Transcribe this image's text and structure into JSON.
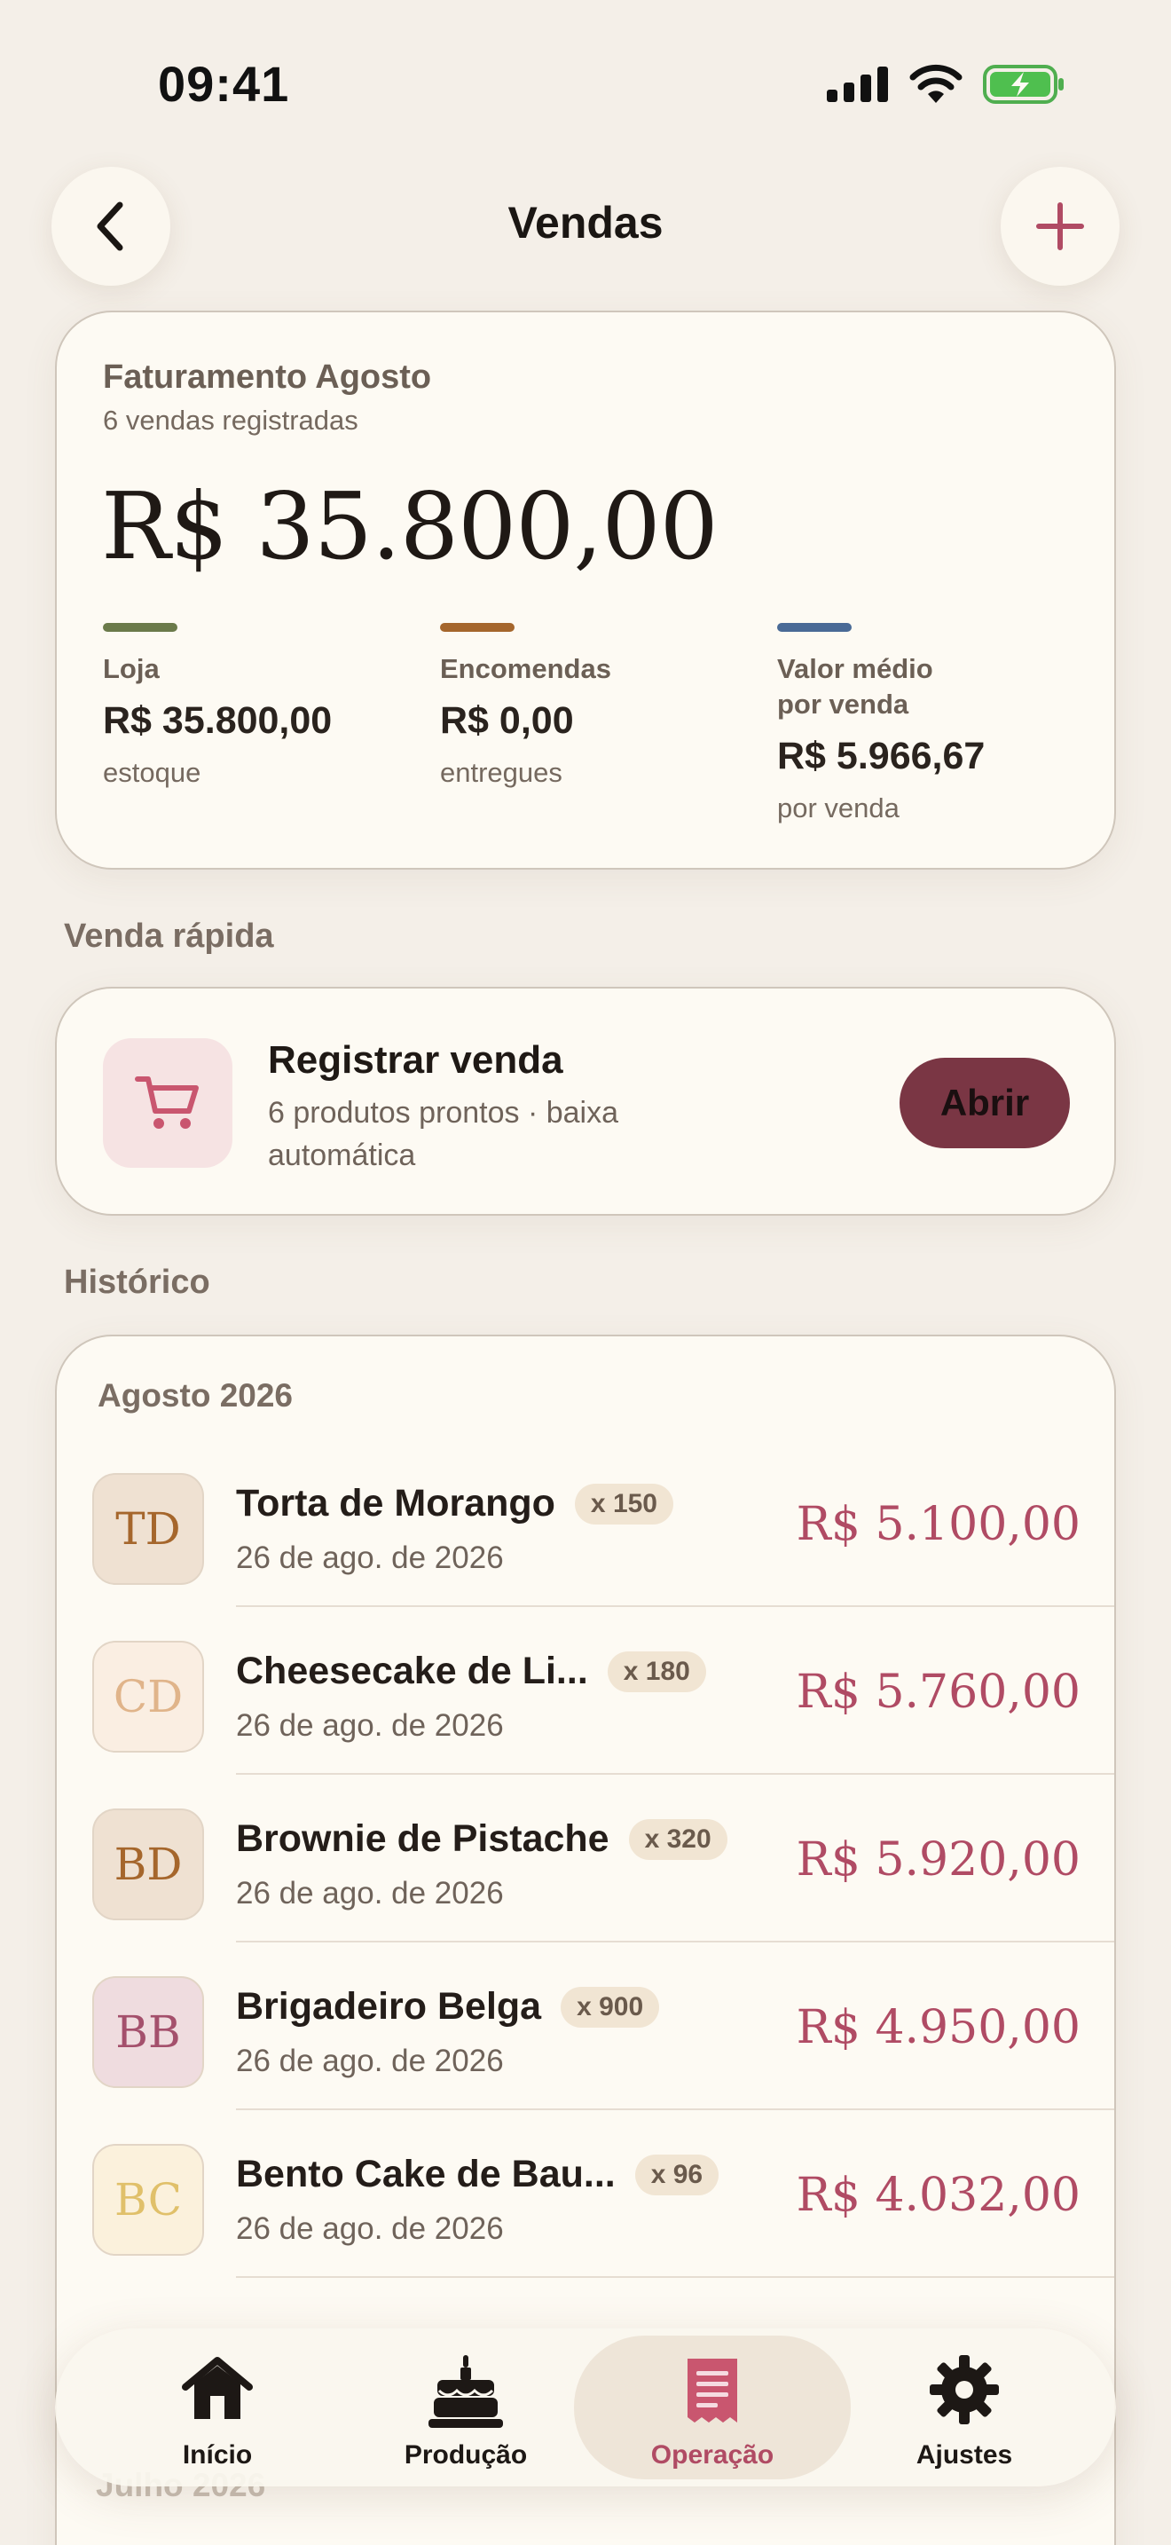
{
  "status": {
    "time": "09:41"
  },
  "header": {
    "title": "Vendas"
  },
  "revenue": {
    "title": "Faturamento Agosto",
    "subtitle": "6 vendas registradas",
    "total": "R$ 35.800,00",
    "metrics": [
      {
        "label": "Loja",
        "value": "R$ 35.800,00",
        "note": "estoque",
        "color": "#6b7a4a"
      },
      {
        "label": "Encomendas",
        "value": "R$ 0,00",
        "note": "entregues",
        "color": "#a5662c"
      },
      {
        "label": "Valor médio por venda",
        "value": "R$ 5.966,67",
        "note": "por venda",
        "color": "#4a6a96"
      }
    ]
  },
  "quick_sale": {
    "section_label": "Venda rápida",
    "title": "Registrar venda",
    "subtitle": "6 produtos prontos · baixa automática",
    "button": "Abrir"
  },
  "history": {
    "section_label": "Histórico",
    "month": "Agosto 2026",
    "rows": [
      {
        "initials": "TD",
        "name": "Torta de Morango",
        "qty": "x 150",
        "date": "26 de ago. de 2026",
        "amount": "R$ 5.100,00",
        "bg": "#efe1d2",
        "fg": "#a5662c"
      },
      {
        "initials": "CD",
        "name": "Cheesecake de Li...",
        "qty": "x 180",
        "date": "26 de ago. de 2026",
        "amount": "R$ 5.760,00",
        "bg": "#faeee2",
        "fg": "#e0b48a"
      },
      {
        "initials": "BD",
        "name": "Brownie de Pistache",
        "qty": "x 320",
        "date": "26 de ago. de 2026",
        "amount": "R$ 5.920,00",
        "bg": "#efe1d2",
        "fg": "#a5662c"
      },
      {
        "initials": "BB",
        "name": "Brigadeiro Belga",
        "qty": "x 900",
        "date": "26 de ago. de 2026",
        "amount": "R$ 4.950,00",
        "bg": "#efdcdf",
        "fg": "#a4506c"
      },
      {
        "initials": "BC",
        "name": "Bento Cake de Bau...",
        "qty": "x 96",
        "date": "26 de ago. de 2026",
        "amount": "R$ 4.032,00",
        "bg": "#fbf1dc",
        "fg": "#e0c06a"
      }
    ],
    "next_month": "Julho 2026"
  },
  "tabs": [
    {
      "label": "Início",
      "icon": "house-icon"
    },
    {
      "label": "Produção",
      "icon": "cake-icon"
    },
    {
      "label": "Operação",
      "icon": "receipt-icon",
      "active": true
    },
    {
      "label": "Ajustes",
      "icon": "gear-icon"
    }
  ],
  "colors": {
    "accent": "#b04b64",
    "button": "#7a3644"
  }
}
